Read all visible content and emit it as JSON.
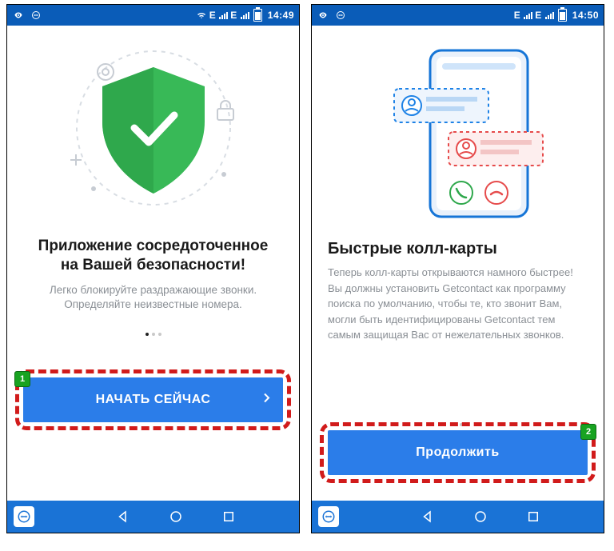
{
  "screens": {
    "one": {
      "status_time": "14:49",
      "status_net": "E",
      "title_line1": "Приложение сосредоточенное",
      "title_line2": "на Вашей безопасности!",
      "desc": "Легко блокируйте раздражающие звонки.\nОпределяйте неизвестные номера.",
      "button": "НАЧАТЬ СЕЙЧАС",
      "marker": "1",
      "dot_active": 0
    },
    "two": {
      "status_time": "14:50",
      "status_net": "E",
      "title": "Быстрые колл-карты",
      "desc": "Теперь колл-карты открываются намного быстрее! Вы должны установить Getcontact как программу поиска по умолчанию, чтобы те, кто звонит Вам, могли быть идентифицированы Getcontact тем самым защищая Вас от нежелательных звонков.",
      "button": "Продолжить",
      "marker": "2",
      "dot_active": 0
    }
  }
}
